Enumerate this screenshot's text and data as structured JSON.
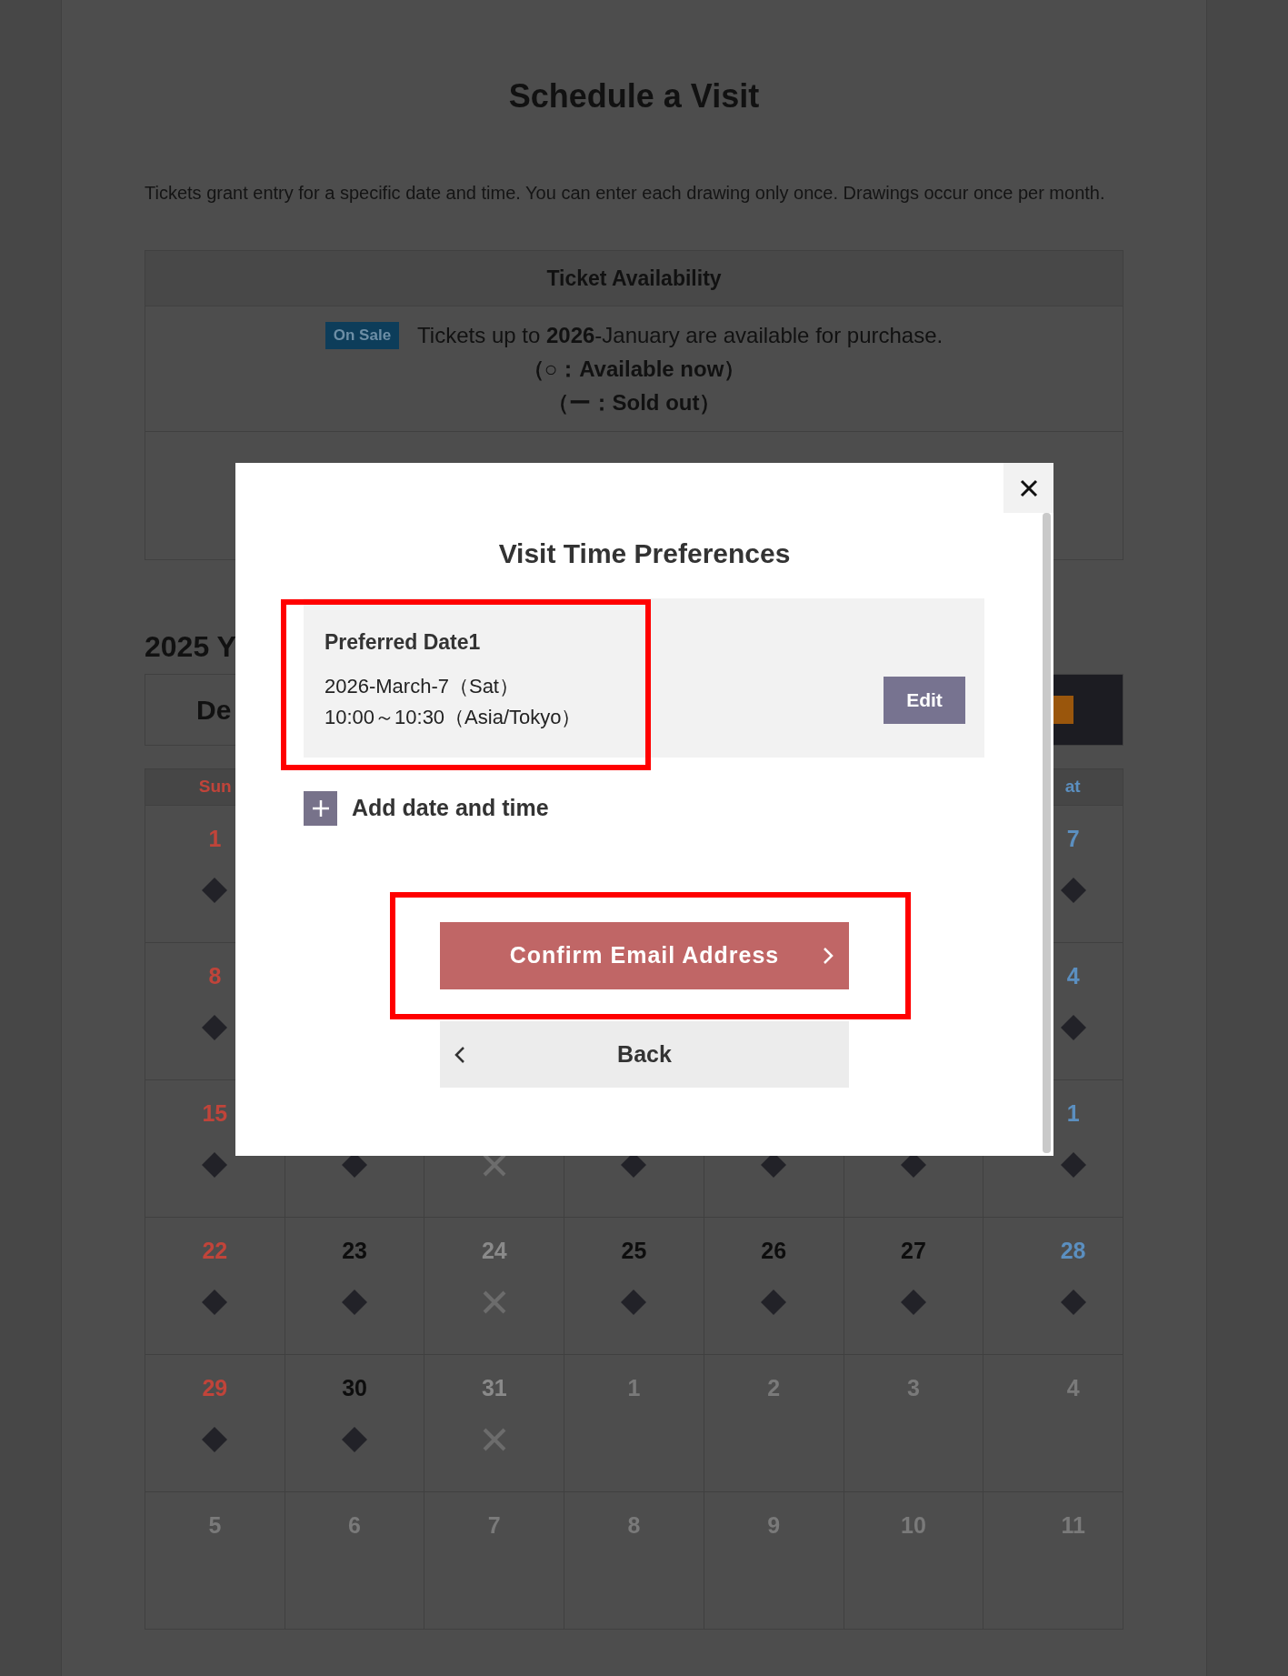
{
  "page": {
    "title": "Schedule a Visit",
    "intro": "Tickets grant entry for a specific date and time. You can enter each drawing only once. Drawings occur once per month."
  },
  "availability": {
    "heading": "Ticket Availability",
    "badge": "On Sale",
    "message": "Tickets up to **2026**-January are available for purchase.",
    "legend": [
      "（○：Available now）",
      "（ー：Sold out）"
    ]
  },
  "calendar": {
    "year_heading": "2025 Y",
    "month": "De",
    "weekdays": {
      "first": "Sun",
      "last": "at"
    },
    "weeks": [
      [
        {
          "kind": "open",
          "day": "1",
          "color": "#c0443a"
        },
        {
          "kind": "blank"
        },
        {
          "kind": "blank"
        },
        {
          "kind": "blank"
        },
        {
          "kind": "blank"
        },
        {
          "kind": "blank"
        },
        {
          "kind": "open",
          "day": "7",
          "color": "#5b8fc0"
        }
      ],
      [
        {
          "kind": "open",
          "day": "8",
          "color": "#c0443a"
        },
        {
          "kind": "blank"
        },
        {
          "kind": "blank"
        },
        {
          "kind": "blank"
        },
        {
          "kind": "blank"
        },
        {
          "kind": "blank"
        },
        {
          "kind": "open",
          "day": "4",
          "color": "#5b8fc0"
        }
      ],
      [
        {
          "kind": "open",
          "day": "15",
          "color": "#c0443a"
        },
        {
          "kind": "open"
        },
        {
          "kind": "closed"
        },
        {
          "kind": "open"
        },
        {
          "kind": "open"
        },
        {
          "kind": "open"
        },
        {
          "kind": "open",
          "day": "1",
          "color": "#5b8fc0"
        }
      ],
      [
        {
          "kind": "open",
          "day": "22",
          "color": "#c0443a"
        },
        {
          "kind": "open",
          "day": "23",
          "color": "#0d0d0d"
        },
        {
          "kind": "closed",
          "day": "24",
          "color": "#8a8a8a"
        },
        {
          "kind": "open",
          "day": "25",
          "color": "#0d0d0d"
        },
        {
          "kind": "open",
          "day": "26",
          "color": "#0d0d0d"
        },
        {
          "kind": "open",
          "day": "27",
          "color": "#0d0d0d"
        },
        {
          "kind": "open",
          "day": "28",
          "color": "#5b8fc0"
        }
      ],
      [
        {
          "kind": "open",
          "day": "29",
          "color": "#c0443a"
        },
        {
          "kind": "open",
          "day": "30",
          "color": "#0d0d0d"
        },
        {
          "kind": "closed",
          "day": "31",
          "color": "#8a8a8a"
        },
        {
          "kind": "plain",
          "day": "1",
          "color": "#7a7a7a"
        },
        {
          "kind": "plain",
          "day": "2",
          "color": "#7a7a7a"
        },
        {
          "kind": "plain",
          "day": "3",
          "color": "#7a7a7a"
        },
        {
          "kind": "plain",
          "day": "4",
          "color": "#7a7a7a"
        }
      ],
      [
        {
          "kind": "plain",
          "day": "5",
          "color": "#7a7a7a"
        },
        {
          "kind": "plain",
          "day": "6",
          "color": "#7a7a7a"
        },
        {
          "kind": "plain",
          "day": "7",
          "color": "#7a7a7a"
        },
        {
          "kind": "plain",
          "day": "8",
          "color": "#7a7a7a"
        },
        {
          "kind": "plain",
          "day": "9",
          "color": "#7a7a7a"
        },
        {
          "kind": "plain",
          "day": "10",
          "color": "#7a7a7a"
        },
        {
          "kind": "plain",
          "day": "11",
          "color": "#7a7a7a"
        }
      ]
    ]
  },
  "modal": {
    "title": "Visit Time Preferences",
    "preferences": [
      {
        "label": "Preferred Date1",
        "date": "2026-March-7（Sat）",
        "time": "10:00～10:30（Asia/Tokyo）",
        "edit": "Edit"
      }
    ],
    "add_label": "Add date and time",
    "confirm": "Confirm Email Address",
    "back": "Back"
  }
}
